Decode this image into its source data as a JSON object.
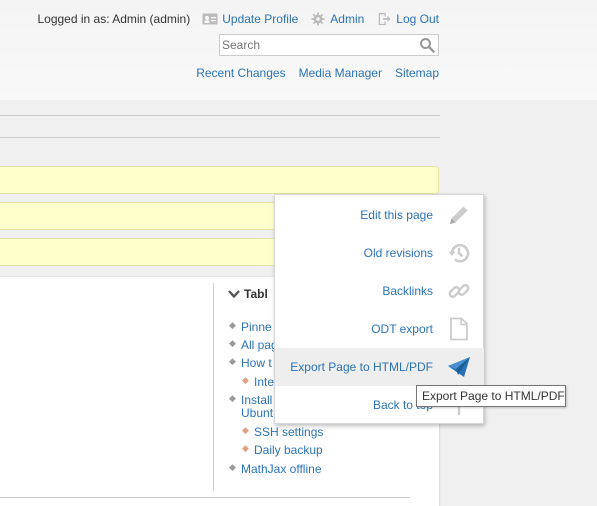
{
  "header": {
    "logged_in_text": "Logged in as: Admin (admin)",
    "user_links": [
      {
        "label": "Update Profile",
        "icon": "profile-card-icon"
      },
      {
        "label": "Admin",
        "icon": "gear-icon"
      },
      {
        "label": "Log Out",
        "icon": "logout-icon"
      }
    ],
    "search": {
      "placeholder": "Search",
      "value": "Search"
    },
    "site_links": [
      "Recent Changes",
      "Media Manager",
      "Sitemap"
    ]
  },
  "toc": {
    "title": "Tabl",
    "items": [
      {
        "label": "Pinne",
        "level": 1
      },
      {
        "label": "All pag",
        "level": 1
      },
      {
        "label": "How t",
        "level": 1
      },
      {
        "label": "Inte",
        "level": 2
      },
      {
        "label": "Install",
        "level": 1
      },
      {
        "label": "Ubunt",
        "level": 1,
        "continuation": true
      },
      {
        "label": "SSH settings",
        "level": 2
      },
      {
        "label": "Daily backup",
        "level": 2
      },
      {
        "label": "MathJax offline",
        "level": 1
      }
    ]
  },
  "page_tools": {
    "items": [
      {
        "label": "Edit this page",
        "icon": "pencil-icon"
      },
      {
        "label": "Old revisions",
        "icon": "history-icon"
      },
      {
        "label": "Backlinks",
        "icon": "link-icon"
      },
      {
        "label": "ODT export",
        "icon": "document-icon"
      },
      {
        "label": "Export Page to HTML/PDF",
        "icon": "paper-plane-icon",
        "active": true
      },
      {
        "label": "Back to top",
        "icon": "arrow-up-icon"
      }
    ]
  },
  "tooltip": {
    "text": "Export Page to HTML/PDF"
  },
  "colors": {
    "link": "#2b73b7",
    "notice_bg": "#ffffcc",
    "active_icon": "#2b73b7"
  }
}
